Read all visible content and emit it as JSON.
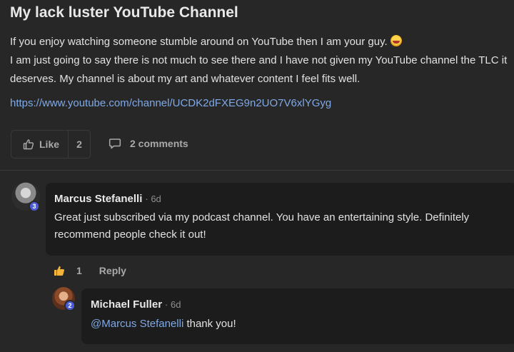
{
  "post": {
    "title": "My lack luster YouTube Channel",
    "body_line1": "If you enjoy watching someone stumble around on YouTube then I am your guy.",
    "body_line2": "I am just going to say there is not much to see there and I have not given my YouTube channel the TLC it deserves. My channel is about my art and whatever content I feel fits well.",
    "link": "https://www.youtube.com/channel/UCDK2dFXEG9n2UO7V6xlYGyg",
    "emoji": "laughing-face-emoji"
  },
  "actions": {
    "like_label": "Like",
    "like_count": "2",
    "comments_label": "2 comments"
  },
  "comments": [
    {
      "author": "Marcus Stefanelli",
      "time": "· 6d",
      "level": "3",
      "text": "Great just subscribed via my podcast channel. You have an entertaining style. Definitely recommend people check it out!",
      "like_count": "1",
      "reply_label": "Reply"
    },
    {
      "author": "Michael Fuller",
      "time": "· 6d",
      "level": "2",
      "mention": "@Marcus Stefanelli",
      "text": " thank you!"
    }
  ],
  "colors": {
    "background": "#272727",
    "bubble": "#1c1c1c",
    "link": "#7fa9e8",
    "badge": "#4b5bd6",
    "liked_thumb": "#f4b43c"
  }
}
